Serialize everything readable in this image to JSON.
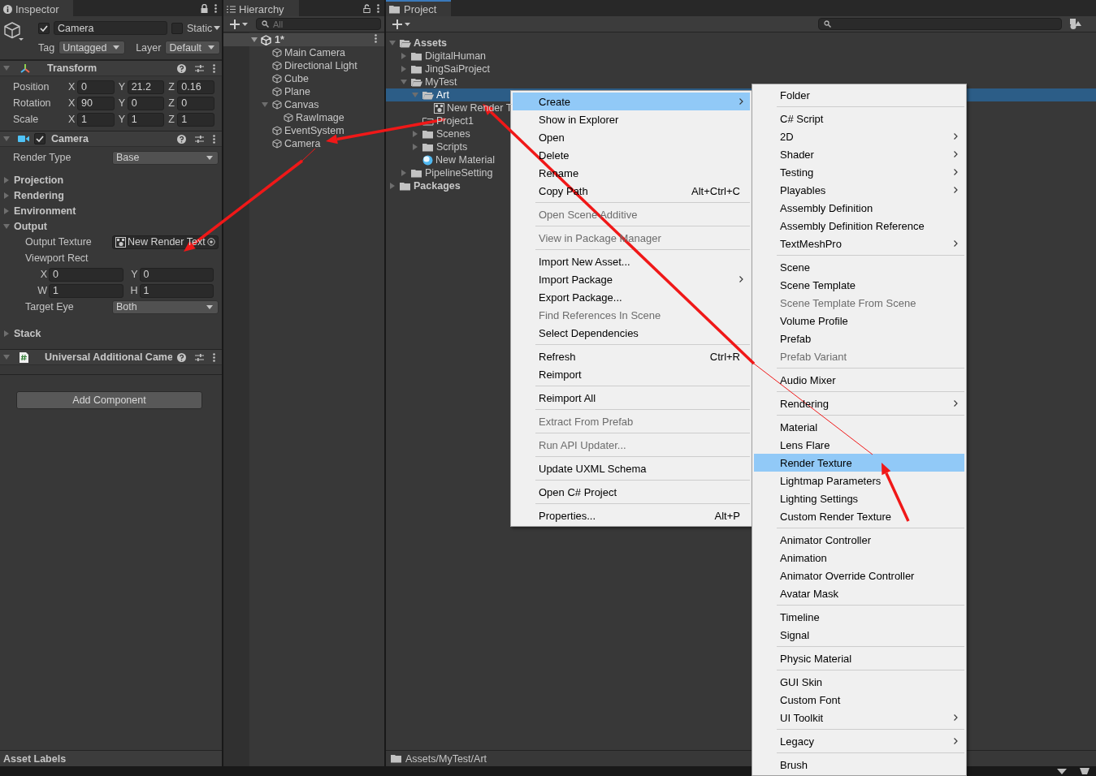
{
  "inspector": {
    "tab": {
      "label": "Inspector",
      "focused": false
    },
    "object": {
      "name": "Camera",
      "active": true,
      "static_label": "Static",
      "static": false,
      "tag_label": "Tag",
      "tag": "Untagged",
      "layer_label": "Layer",
      "layer": "Default"
    },
    "transform": {
      "title": "Transform",
      "expanded": true,
      "rows": [
        {
          "label": "Position",
          "values": [
            {
              "axis": "X",
              "value": "0"
            },
            {
              "axis": "Y",
              "value": "21.2"
            },
            {
              "axis": "Z",
              "value": "0.16"
            }
          ]
        },
        {
          "label": "Rotation",
          "values": [
            {
              "axis": "X",
              "value": "90"
            },
            {
              "axis": "Y",
              "value": "0"
            },
            {
              "axis": "Z",
              "value": "0"
            }
          ]
        },
        {
          "label": "Scale",
          "values": [
            {
              "axis": "X",
              "value": "1"
            },
            {
              "axis": "Y",
              "value": "1"
            },
            {
              "axis": "Z",
              "value": "1"
            }
          ]
        }
      ]
    },
    "camera": {
      "title": "Camera",
      "expanded": true,
      "enabled": true,
      "fields": [
        {
          "kind": "dropdown",
          "label": "Render Type",
          "value": "Base"
        },
        {
          "kind": "section",
          "label": "Projection",
          "expanded": false
        },
        {
          "kind": "section",
          "label": "Rendering",
          "expanded": false
        },
        {
          "kind": "section",
          "label": "Environment",
          "expanded": false
        },
        {
          "kind": "section",
          "label": "Output",
          "expanded": true,
          "children": [
            {
              "kind": "object",
              "label": "Output Texture",
              "value": "New Render Text"
            },
            {
              "kind": "rect",
              "label": "Viewport Rect",
              "fields": [
                {
                  "label": "X",
                  "value": "0"
                },
                {
                  "label": "Y",
                  "value": "0"
                },
                {
                  "label": "W",
                  "value": "1"
                },
                {
                  "label": "H",
                  "value": "1"
                }
              ]
            },
            {
              "kind": "dropdown",
              "label": "Target Eye",
              "value": "Both"
            }
          ]
        },
        {
          "kind": "section",
          "label": "Stack",
          "expanded": false
        }
      ]
    },
    "additional": {
      "title": "Universal Additional Came",
      "expanded": true
    },
    "add_component": "Add Component",
    "footer": "Asset Labels"
  },
  "hierarchy": {
    "tab": {
      "label": "Hierarchy",
      "focused": false
    },
    "search_placeholder": "All",
    "scene": {
      "name": "1*",
      "expanded": true,
      "children": [
        {
          "name": "Main Camera"
        },
        {
          "name": "Directional Light"
        },
        {
          "name": "Cube"
        },
        {
          "name": "Plane"
        },
        {
          "name": "Canvas",
          "expanded": true,
          "children": [
            {
              "name": "RawImage"
            }
          ]
        },
        {
          "name": "EventSystem"
        },
        {
          "name": "Camera"
        }
      ]
    }
  },
  "project": {
    "tab": {
      "label": "Project",
      "focused": true
    },
    "tree": [
      {
        "name": "Assets",
        "kind": "folder",
        "expanded": true,
        "selected": false,
        "children": [
          {
            "name": "DigitalHuman",
            "kind": "folder",
            "expanded": false,
            "selected": false
          },
          {
            "name": "JingSaiProject",
            "kind": "folder",
            "expanded": false,
            "selected": false
          },
          {
            "name": "MyTest",
            "kind": "folder",
            "expanded": true,
            "selected": false,
            "children": [
              {
                "name": "Art",
                "kind": "folder",
                "expanded": true,
                "selected": true,
                "children": [
                  {
                    "name": "New Render T",
                    "kind": "render_texture",
                    "selected": false
                  }
                ]
              },
              {
                "name": "Project1",
                "kind": "empty_folder",
                "selected": false
              },
              {
                "name": "Scenes",
                "kind": "folder",
                "expanded": false,
                "selected": false
              },
              {
                "name": "Scripts",
                "kind": "folder",
                "expanded": false,
                "selected": false
              },
              {
                "name": "New Material",
                "kind": "material",
                "selected": false
              }
            ]
          },
          {
            "name": "PipelineSetting",
            "kind": "folder",
            "expanded": false,
            "selected": false
          }
        ]
      },
      {
        "name": "Packages",
        "kind": "folder",
        "expanded": false,
        "selected": false
      }
    ],
    "path": "Assets/MyTest/Art"
  },
  "context_menu": {
    "items": [
      {
        "kind": "item",
        "label": "Create",
        "selected": true,
        "disabled": false,
        "submenu": true
      },
      {
        "kind": "item",
        "label": "Show in Explorer",
        "selected": false,
        "disabled": false
      },
      {
        "kind": "item",
        "label": "Open",
        "selected": false,
        "disabled": false
      },
      {
        "kind": "item",
        "label": "Delete",
        "selected": false,
        "disabled": false
      },
      {
        "kind": "item",
        "label": "Rename",
        "selected": false,
        "disabled": false
      },
      {
        "kind": "item",
        "label": "Copy Path",
        "shortcut": "Alt+Ctrl+C",
        "selected": false,
        "disabled": false
      },
      {
        "kind": "separator"
      },
      {
        "kind": "item",
        "label": "Open Scene Additive",
        "selected": false,
        "disabled": true
      },
      {
        "kind": "separator"
      },
      {
        "kind": "item",
        "label": "View in Package Manager",
        "selected": false,
        "disabled": true
      },
      {
        "kind": "separator"
      },
      {
        "kind": "item",
        "label": "Import New Asset...",
        "selected": false,
        "disabled": false
      },
      {
        "kind": "item",
        "label": "Import Package",
        "selected": false,
        "disabled": false,
        "submenu": true
      },
      {
        "kind": "item",
        "label": "Export Package...",
        "selected": false,
        "disabled": false
      },
      {
        "kind": "item",
        "label": "Find References In Scene",
        "selected": false,
        "disabled": true
      },
      {
        "kind": "item",
        "label": "Select Dependencies",
        "selected": false,
        "disabled": false
      },
      {
        "kind": "separator"
      },
      {
        "kind": "item",
        "label": "Refresh",
        "shortcut": "Ctrl+R",
        "selected": false,
        "disabled": false
      },
      {
        "kind": "item",
        "label": "Reimport",
        "selected": false,
        "disabled": false
      },
      {
        "kind": "separator"
      },
      {
        "kind": "item",
        "label": "Reimport All",
        "selected": false,
        "disabled": false
      },
      {
        "kind": "separator"
      },
      {
        "kind": "item",
        "label": "Extract From Prefab",
        "selected": false,
        "disabled": true
      },
      {
        "kind": "separator"
      },
      {
        "kind": "item",
        "label": "Run API Updater...",
        "selected": false,
        "disabled": true
      },
      {
        "kind": "separator"
      },
      {
        "kind": "item",
        "label": "Update UXML Schema",
        "selected": false,
        "disabled": false
      },
      {
        "kind": "separator"
      },
      {
        "kind": "item",
        "label": "Open C# Project",
        "selected": false,
        "disabled": false
      },
      {
        "kind": "separator"
      },
      {
        "kind": "item",
        "label": "Properties...",
        "shortcut": "Alt+P",
        "selected": false,
        "disabled": false
      }
    ]
  },
  "create_menu": {
    "items": [
      {
        "kind": "item",
        "label": "Folder",
        "selected": false,
        "disabled": false
      },
      {
        "kind": "separator"
      },
      {
        "kind": "item",
        "label": "C# Script",
        "selected": false,
        "disabled": false
      },
      {
        "kind": "item",
        "label": "2D",
        "selected": false,
        "disabled": false,
        "submenu": true
      },
      {
        "kind": "item",
        "label": "Shader",
        "selected": false,
        "disabled": false,
        "submenu": true
      },
      {
        "kind": "item",
        "label": "Testing",
        "selected": false,
        "disabled": false,
        "submenu": true
      },
      {
        "kind": "item",
        "label": "Playables",
        "selected": false,
        "disabled": false,
        "submenu": true
      },
      {
        "kind": "item",
        "label": "Assembly Definition",
        "selected": false,
        "disabled": false
      },
      {
        "kind": "item",
        "label": "Assembly Definition Reference",
        "selected": false,
        "disabled": false
      },
      {
        "kind": "item",
        "label": "TextMeshPro",
        "selected": false,
        "disabled": false,
        "submenu": true
      },
      {
        "kind": "separator"
      },
      {
        "kind": "item",
        "label": "Scene",
        "selected": false,
        "disabled": false
      },
      {
        "kind": "item",
        "label": "Scene Template",
        "selected": false,
        "disabled": false
      },
      {
        "kind": "item",
        "label": "Scene Template From Scene",
        "selected": false,
        "disabled": true
      },
      {
        "kind": "item",
        "label": "Volume Profile",
        "selected": false,
        "disabled": false
      },
      {
        "kind": "item",
        "label": "Prefab",
        "selected": false,
        "disabled": false
      },
      {
        "kind": "item",
        "label": "Prefab Variant",
        "selected": false,
        "disabled": true
      },
      {
        "kind": "separator"
      },
      {
        "kind": "item",
        "label": "Audio Mixer",
        "selected": false,
        "disabled": false
      },
      {
        "kind": "separator"
      },
      {
        "kind": "item",
        "label": "Rendering",
        "selected": false,
        "disabled": false,
        "submenu": true
      },
      {
        "kind": "separator"
      },
      {
        "kind": "item",
        "label": "Material",
        "selected": false,
        "disabled": false
      },
      {
        "kind": "item",
        "label": "Lens Flare",
        "selected": false,
        "disabled": false
      },
      {
        "kind": "item",
        "label": "Render Texture",
        "selected": true,
        "disabled": false
      },
      {
        "kind": "item",
        "label": "Lightmap Parameters",
        "selected": false,
        "disabled": false
      },
      {
        "kind": "item",
        "label": "Lighting Settings",
        "selected": false,
        "disabled": false
      },
      {
        "kind": "item",
        "label": "Custom Render Texture",
        "selected": false,
        "disabled": false
      },
      {
        "kind": "separator"
      },
      {
        "kind": "item",
        "label": "Animator Controller",
        "selected": false,
        "disabled": false
      },
      {
        "kind": "item",
        "label": "Animation",
        "selected": false,
        "disabled": false
      },
      {
        "kind": "item",
        "label": "Animator Override Controller",
        "selected": false,
        "disabled": false
      },
      {
        "kind": "item",
        "label": "Avatar Mask",
        "selected": false,
        "disabled": false
      },
      {
        "kind": "separator"
      },
      {
        "kind": "item",
        "label": "Timeline",
        "selected": false,
        "disabled": false
      },
      {
        "kind": "item",
        "label": "Signal",
        "selected": false,
        "disabled": false
      },
      {
        "kind": "separator"
      },
      {
        "kind": "item",
        "label": "Physic Material",
        "selected": false,
        "disabled": false
      },
      {
        "kind": "separator"
      },
      {
        "kind": "item",
        "label": "GUI Skin",
        "selected": false,
        "disabled": false
      },
      {
        "kind": "item",
        "label": "Custom Font",
        "selected": false,
        "disabled": false
      },
      {
        "kind": "item",
        "label": "UI Toolkit",
        "selected": false,
        "disabled": false,
        "submenu": true
      },
      {
        "kind": "separator"
      },
      {
        "kind": "item",
        "label": "Legacy",
        "selected": false,
        "disabled": false,
        "submenu": true
      },
      {
        "kind": "separator"
      },
      {
        "kind": "item",
        "label": "Brush",
        "selected": false,
        "disabled": false
      }
    ]
  }
}
